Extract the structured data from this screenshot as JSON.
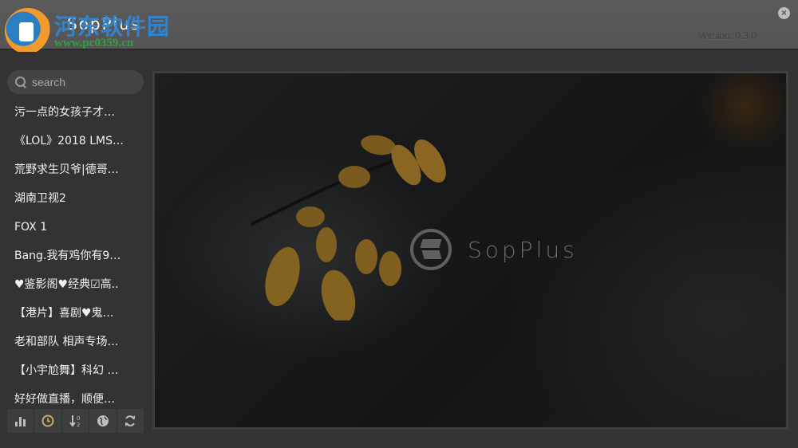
{
  "window": {
    "title": "SopPlus",
    "version": "Version: 0.3.0",
    "close_icon": "close-icon"
  },
  "watermark": {
    "site_name": "河东软件园",
    "url": "www.pc0359.cn"
  },
  "sidebar": {
    "search": {
      "placeholder": "search",
      "value": ""
    },
    "channels": [
      {
        "label": "污一点的女孩子才…"
      },
      {
        "label": "《LOL》2018 LMS…"
      },
      {
        "label": "荒野求生贝爷|德哥…"
      },
      {
        "label": "湖南卫视2"
      },
      {
        "label": "FOX 1"
      },
      {
        "label": "Bang.我有鸡你有9…"
      },
      {
        "label": "♥鉴影阁♥经典☑高.."
      },
      {
        "label": "【港片】喜剧♥鬼…"
      },
      {
        "label": "老和部队 相声专场…"
      },
      {
        "label": "【小宇尬舞】科幻 …"
      },
      {
        "label": "好好做直播，顺便…"
      }
    ],
    "toolbar": [
      {
        "name": "chart-icon",
        "active": false
      },
      {
        "name": "clock-icon",
        "active": true
      },
      {
        "name": "sort-icon",
        "active": false
      },
      {
        "name": "globe-icon",
        "active": false
      },
      {
        "name": "refresh-icon",
        "active": false
      }
    ]
  },
  "player": {
    "logo_text": "SopPlus"
  },
  "colors": {
    "accent_active": "#c8a86a",
    "icon_default": "#bdbdbd",
    "background": "#333333",
    "titlebar": "#585858"
  }
}
